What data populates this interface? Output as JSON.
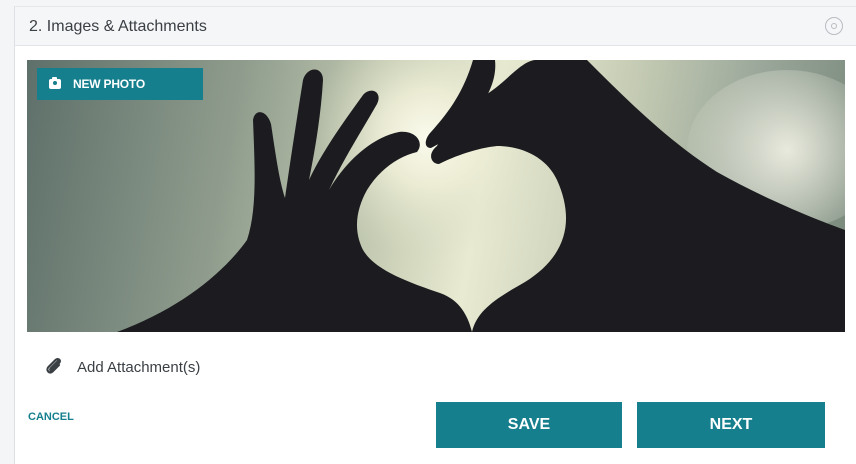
{
  "panel": {
    "title": "2. Images & Attachments",
    "collapse_icon": "circle-collapse-icon"
  },
  "photo": {
    "alt": "Silhouette of two hands forming a heart shape against the sky",
    "new_photo_label": "NEW PHOTO",
    "new_photo_icon": "camera-icon"
  },
  "attachments": {
    "label": "Add Attachment(s)",
    "icon": "paperclip-icon"
  },
  "actions": {
    "cancel_label": "CANCEL",
    "save_label": "SAVE",
    "next_label": "NEXT"
  },
  "colors": {
    "accent": "#157f8d",
    "text": "#3a3f44",
    "header_bg": "#f5f6f7"
  }
}
